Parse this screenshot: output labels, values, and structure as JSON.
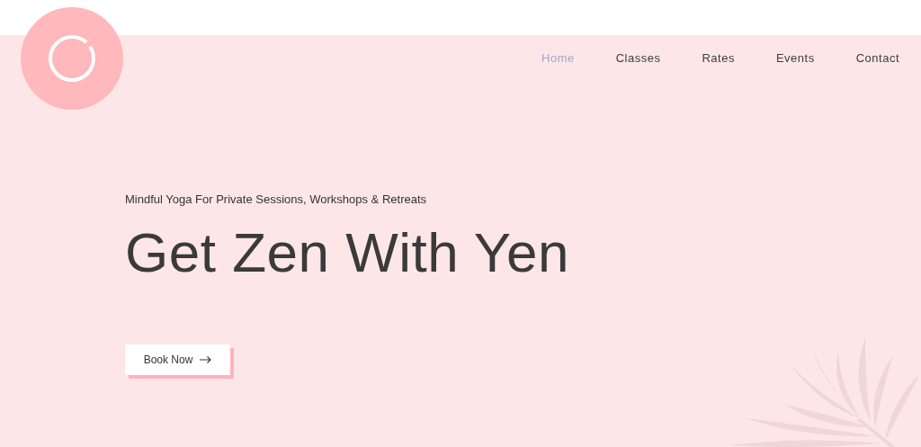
{
  "nav": [
    {
      "label": "Home",
      "selected": true
    },
    {
      "label": "Classes",
      "selected": false
    },
    {
      "label": "Rates",
      "selected": false
    },
    {
      "label": "Events",
      "selected": false
    },
    {
      "label": "Contact",
      "selected": false
    }
  ],
  "hero": {
    "tagline": "Mindful Yoga For Private Sessions, Workshops & Retreats",
    "title": "Get Zen With Yen",
    "button": "Book Now"
  }
}
